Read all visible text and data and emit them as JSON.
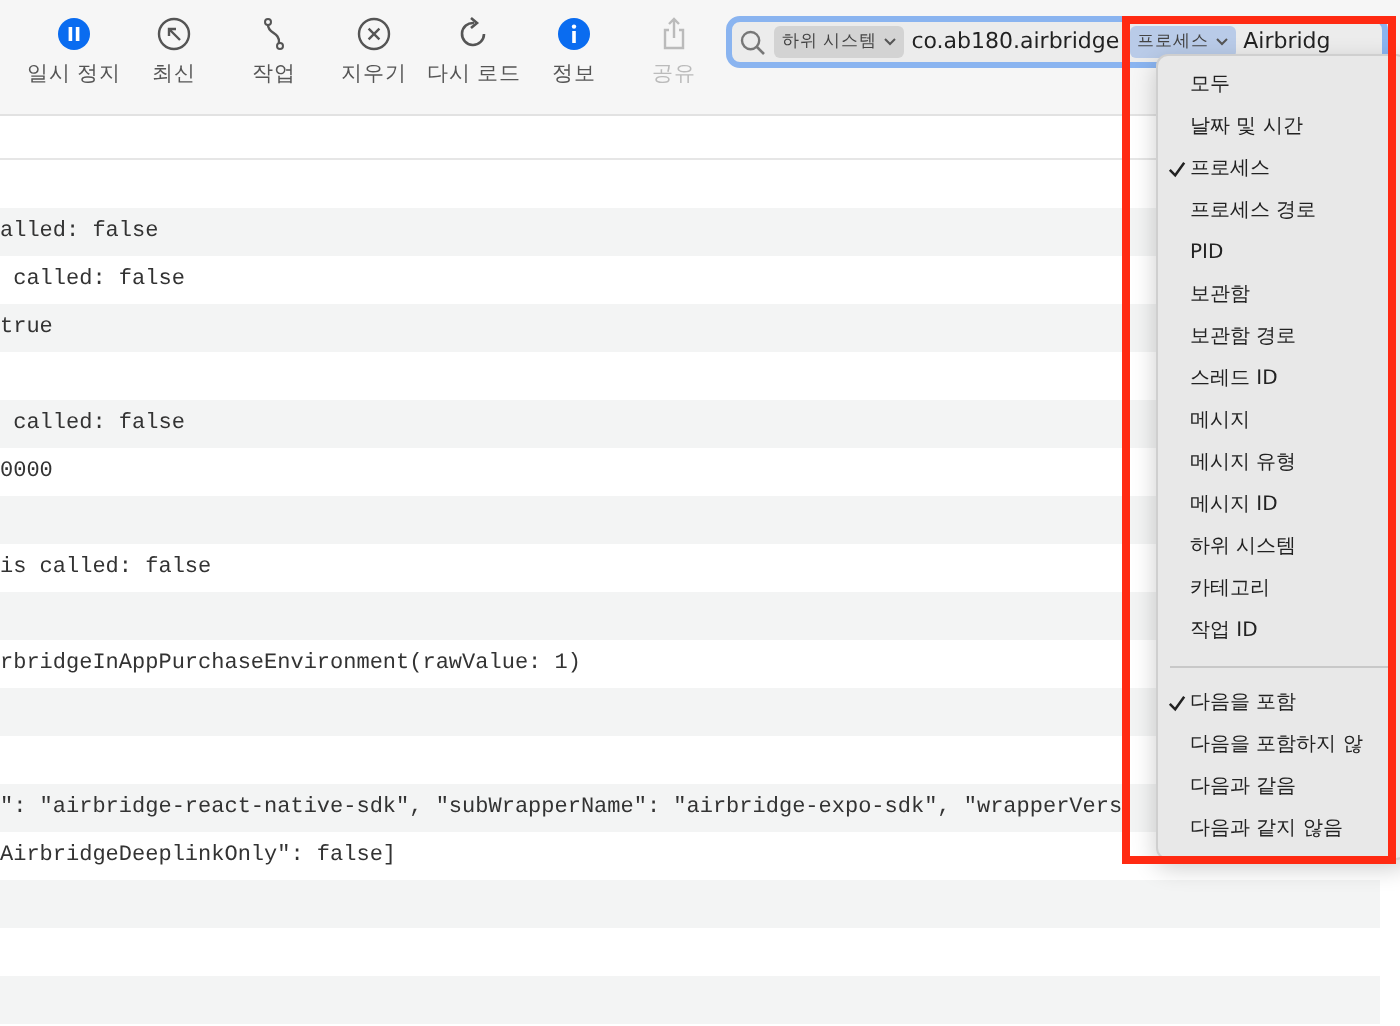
{
  "toolbar": {
    "buttons": [
      {
        "label": "일시 정지",
        "kind": "pause",
        "disabled": false
      },
      {
        "label": "최신",
        "kind": "latest",
        "disabled": false
      },
      {
        "label": "작업",
        "kind": "activity",
        "disabled": false
      },
      {
        "label": "지우기",
        "kind": "clear",
        "disabled": false
      },
      {
        "label": "다시 로드",
        "kind": "reload",
        "disabled": false
      },
      {
        "label": "정보",
        "kind": "info",
        "disabled": false
      },
      {
        "label": "공유",
        "kind": "share",
        "disabled": true
      }
    ]
  },
  "search": {
    "tokens": [
      {
        "field": "하위 시스템",
        "value": "co.ab180.airbridge",
        "selected": false
      },
      {
        "field": "프로세스",
        "value": "Airbridg",
        "selected": true
      }
    ]
  },
  "filter_menu": {
    "fields": [
      {
        "label": "모두",
        "selected": false
      },
      {
        "label": "날짜 및 시간",
        "selected": false
      },
      {
        "label": "프로세스",
        "selected": true
      },
      {
        "label": "프로세스 경로",
        "selected": false
      },
      {
        "label": "PID",
        "selected": false
      },
      {
        "label": "보관함",
        "selected": false
      },
      {
        "label": "보관함 경로",
        "selected": false
      },
      {
        "label": "스레드 ID",
        "selected": false
      },
      {
        "label": "메시지",
        "selected": false
      },
      {
        "label": "메시지 유형",
        "selected": false
      },
      {
        "label": "메시지 ID",
        "selected": false
      },
      {
        "label": "하위 시스템",
        "selected": false
      },
      {
        "label": "카테고리",
        "selected": false
      },
      {
        "label": "작업 ID",
        "selected": false
      }
    ],
    "operators": [
      {
        "label": "다음을 포함",
        "selected": true
      },
      {
        "label": "다음을 포함하지 않",
        "selected": false
      },
      {
        "label": "다음과 같음",
        "selected": false
      },
      {
        "label": "다음과 같지 않음",
        "selected": false
      }
    ]
  },
  "log_rows": [
    {
      "text": ""
    },
    {
      "text": "alled: false"
    },
    {
      "text": " called: false"
    },
    {
      "text": "true"
    },
    {
      "text": ""
    },
    {
      "text": " called: false"
    },
    {
      "text": "0000"
    },
    {
      "text": ""
    },
    {
      "text": "is called: false"
    },
    {
      "text": ""
    },
    {
      "text": "rbridgeInAppPurchaseEnvironment(rawValue: 1)"
    },
    {
      "text": ""
    },
    {
      "text": ""
    },
    {
      "text": "\": \"airbridge-react-native-sdk\", \"subWrapperName\": \"airbridge-expo-sdk\", \"wrapperVers"
    },
    {
      "text": "AirbridgeDeeplinkOnly\": false]"
    },
    {
      "text": ""
    },
    {
      "text": ""
    },
    {
      "text": ""
    }
  ]
}
